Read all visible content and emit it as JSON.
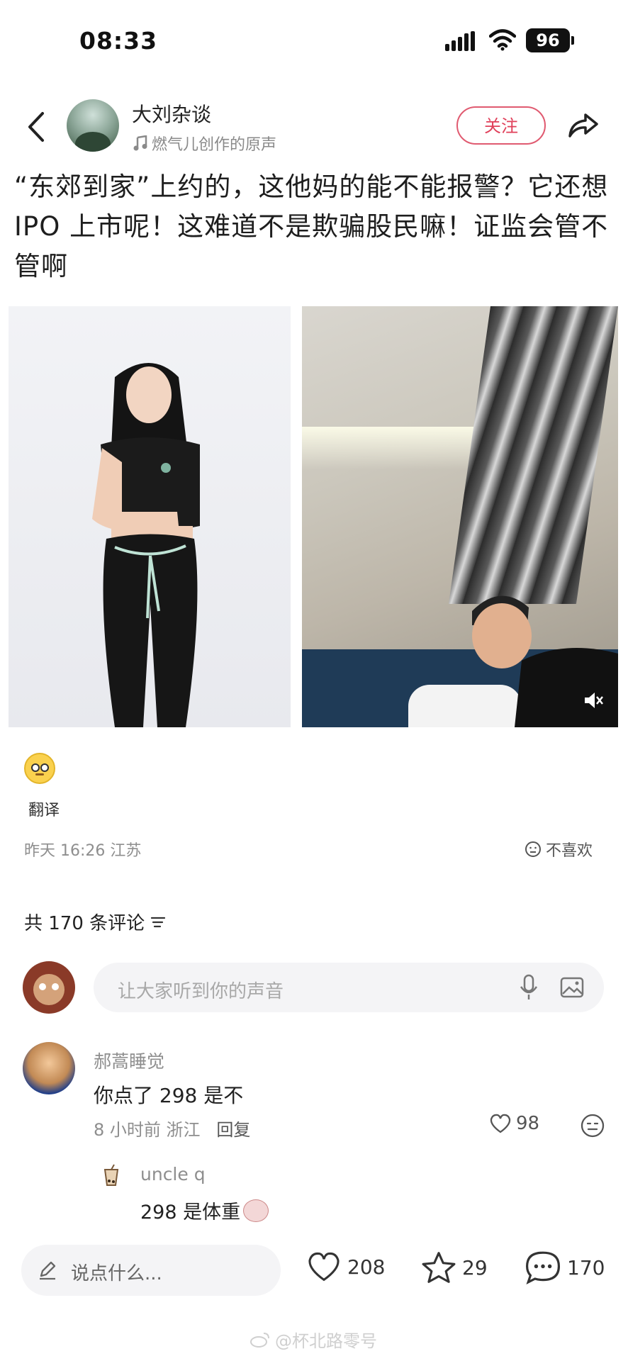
{
  "status_bar": {
    "time": "08:33",
    "battery": "96"
  },
  "header": {
    "author_name": "大刘杂谈",
    "music_label": "燃气儿创作的原声",
    "follow_label": "关注"
  },
  "post": {
    "text": "“东郊到家”上约的，这他妈的能不能报警？它还想 IPO 上市呢！这难道不是欺骗股民嘛！证监会管不管啊",
    "translate_label": "翻译",
    "meta": "昨天 16:26 江苏",
    "dislike_label": "不喜欢"
  },
  "comments_section": {
    "count_label": "共 170 条评论",
    "input_placeholder": "让大家听到你的声音",
    "comments": [
      {
        "name": "郝蒿睡觉",
        "text": "你点了 298 是不",
        "time_location": "8 小时前  浙江",
        "reply_label": "回复",
        "likes": "98"
      }
    ],
    "reply": {
      "name": "uncle q",
      "text": "298 是体重"
    }
  },
  "bottom_bar": {
    "say_placeholder": "说点什么...",
    "likes": "208",
    "favorites": "29",
    "comments": "170"
  },
  "watermark": "@杯北路零号",
  "icons": {
    "back": "chevron-left-icon",
    "share": "share-arrow-icon",
    "music": "music-note-icon",
    "mute": "speaker-mute-icon",
    "mic": "microphone-icon",
    "image": "image-icon",
    "heart": "heart-icon",
    "star": "star-icon",
    "comment": "chat-bubble-icon",
    "pen": "pen-icon",
    "sort": "sort-icon",
    "dislike": "unhappy-face-icon"
  },
  "colors": {
    "accent": "#e0405a",
    "text": "#222222",
    "muted": "#8e8e8e",
    "input_bg": "#f4f4f6"
  }
}
